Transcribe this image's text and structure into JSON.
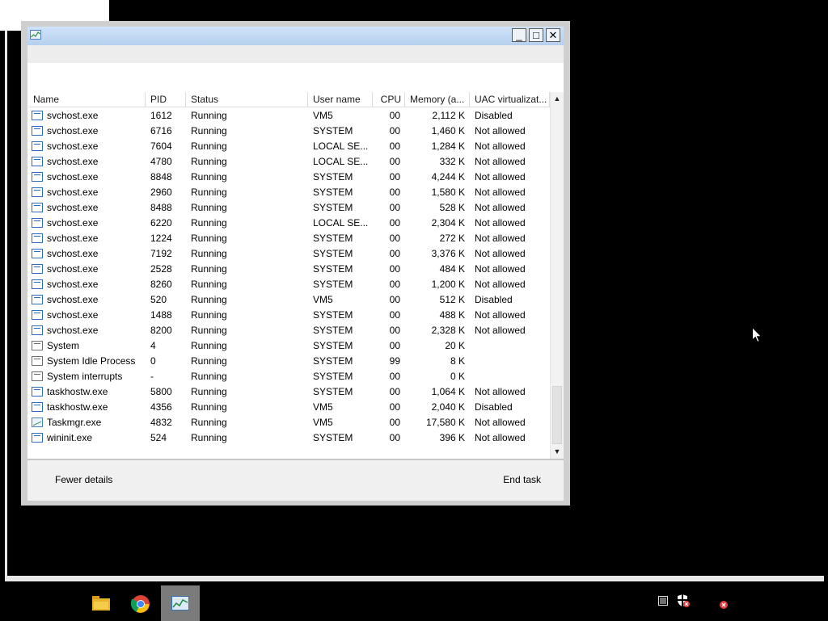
{
  "window": {
    "caption_buttons": [
      "_",
      "□",
      "✕"
    ],
    "icon": "taskmgr-chart-icon"
  },
  "table": {
    "columns": [
      "Name",
      "PID",
      "Status",
      "User name",
      "CPU",
      "Memory (a...",
      "UAC virtualizat..."
    ],
    "rows": [
      {
        "name": "svchost.exe",
        "pid": "1612",
        "status": "Running",
        "user": "VM5",
        "cpu": "00",
        "memory": "2,112 K",
        "uac": "Disabled",
        "icon": "process-icon"
      },
      {
        "name": "svchost.exe",
        "pid": "6716",
        "status": "Running",
        "user": "SYSTEM",
        "cpu": "00",
        "memory": "1,460 K",
        "uac": "Not allowed",
        "icon": "process-icon"
      },
      {
        "name": "svchost.exe",
        "pid": "7604",
        "status": "Running",
        "user": "LOCAL SE...",
        "cpu": "00",
        "memory": "1,284 K",
        "uac": "Not allowed",
        "icon": "process-icon"
      },
      {
        "name": "svchost.exe",
        "pid": "4780",
        "status": "Running",
        "user": "LOCAL SE...",
        "cpu": "00",
        "memory": "332 K",
        "uac": "Not allowed",
        "icon": "process-icon"
      },
      {
        "name": "svchost.exe",
        "pid": "8848",
        "status": "Running",
        "user": "SYSTEM",
        "cpu": "00",
        "memory": "4,244 K",
        "uac": "Not allowed",
        "icon": "process-icon"
      },
      {
        "name": "svchost.exe",
        "pid": "2960",
        "status": "Running",
        "user": "SYSTEM",
        "cpu": "00",
        "memory": "1,580 K",
        "uac": "Not allowed",
        "icon": "process-icon"
      },
      {
        "name": "svchost.exe",
        "pid": "8488",
        "status": "Running",
        "user": "SYSTEM",
        "cpu": "00",
        "memory": "528 K",
        "uac": "Not allowed",
        "icon": "process-icon"
      },
      {
        "name": "svchost.exe",
        "pid": "6220",
        "status": "Running",
        "user": "LOCAL SE...",
        "cpu": "00",
        "memory": "2,304 K",
        "uac": "Not allowed",
        "icon": "process-icon"
      },
      {
        "name": "svchost.exe",
        "pid": "1224",
        "status": "Running",
        "user": "SYSTEM",
        "cpu": "00",
        "memory": "272 K",
        "uac": "Not allowed",
        "icon": "process-icon"
      },
      {
        "name": "svchost.exe",
        "pid": "7192",
        "status": "Running",
        "user": "SYSTEM",
        "cpu": "00",
        "memory": "3,376 K",
        "uac": "Not allowed",
        "icon": "process-icon"
      },
      {
        "name": "svchost.exe",
        "pid": "2528",
        "status": "Running",
        "user": "SYSTEM",
        "cpu": "00",
        "memory": "484 K",
        "uac": "Not allowed",
        "icon": "process-icon"
      },
      {
        "name": "svchost.exe",
        "pid": "8260",
        "status": "Running",
        "user": "SYSTEM",
        "cpu": "00",
        "memory": "1,200 K",
        "uac": "Not allowed",
        "icon": "process-icon"
      },
      {
        "name": "svchost.exe",
        "pid": "520",
        "status": "Running",
        "user": "VM5",
        "cpu": "00",
        "memory": "512 K",
        "uac": "Disabled",
        "icon": "process-icon"
      },
      {
        "name": "svchost.exe",
        "pid": "1488",
        "status": "Running",
        "user": "SYSTEM",
        "cpu": "00",
        "memory": "488 K",
        "uac": "Not allowed",
        "icon": "process-icon"
      },
      {
        "name": "svchost.exe",
        "pid": "8200",
        "status": "Running",
        "user": "SYSTEM",
        "cpu": "00",
        "memory": "2,328 K",
        "uac": "Not allowed",
        "icon": "process-icon"
      },
      {
        "name": "System",
        "pid": "4",
        "status": "Running",
        "user": "SYSTEM",
        "cpu": "00",
        "memory": "20 K",
        "uac": "",
        "icon": "system-process-icon"
      },
      {
        "name": "System Idle Process",
        "pid": "0",
        "status": "Running",
        "user": "SYSTEM",
        "cpu": "99",
        "memory": "8 K",
        "uac": "",
        "icon": "system-process-icon"
      },
      {
        "name": "System interrupts",
        "pid": "-",
        "status": "Running",
        "user": "SYSTEM",
        "cpu": "00",
        "memory": "0 K",
        "uac": "",
        "icon": "system-process-icon"
      },
      {
        "name": "taskhostw.exe",
        "pid": "5800",
        "status": "Running",
        "user": "SYSTEM",
        "cpu": "00",
        "memory": "1,064 K",
        "uac": "Not allowed",
        "icon": "process-icon"
      },
      {
        "name": "taskhostw.exe",
        "pid": "4356",
        "status": "Running",
        "user": "VM5",
        "cpu": "00",
        "memory": "2,040 K",
        "uac": "Disabled",
        "icon": "process-icon"
      },
      {
        "name": "Taskmgr.exe",
        "pid": "4832",
        "status": "Running",
        "user": "VM5",
        "cpu": "00",
        "memory": "17,580 K",
        "uac": "Not allowed",
        "icon": "taskmgr-icon"
      },
      {
        "name": "wininit.exe",
        "pid": "524",
        "status": "Running",
        "user": "SYSTEM",
        "cpu": "00",
        "memory": "396 K",
        "uac": "Not allowed",
        "icon": "process-icon"
      }
    ]
  },
  "footer": {
    "fewer_details": "Fewer details",
    "end_task": "End task"
  },
  "taskbar": {
    "pinned": [
      "folder-icon",
      "chrome-icon",
      "task-manager-icon"
    ],
    "active": "task-manager-icon",
    "tray": [
      "window-icon",
      "shield-icon",
      "error-icon"
    ]
  },
  "colors": {
    "desktop": "#000000",
    "titlebar": "#b9d3ef",
    "window_frame": "#cfcfcf",
    "footer": "#f0f0f0",
    "process_icon": "#2b6cc4",
    "error_badge": "#e23b3b"
  }
}
